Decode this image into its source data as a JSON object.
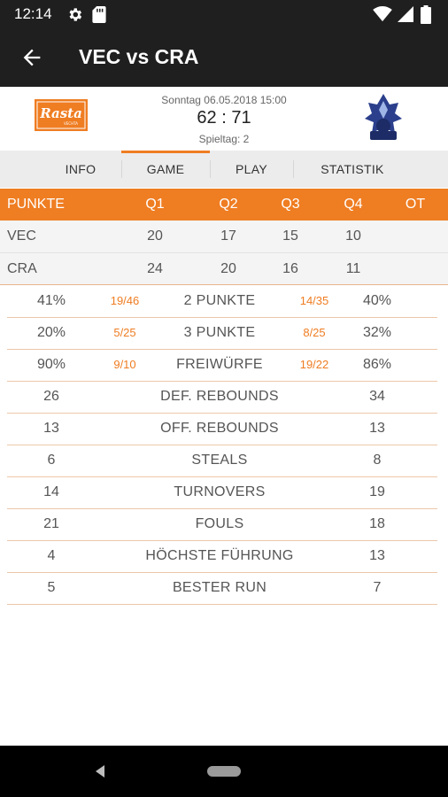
{
  "status_bar": {
    "time": "12:14"
  },
  "app_bar": {
    "title": "VEC vs CRA"
  },
  "game": {
    "date": "Sonntag 06.05.2018 15:00",
    "score": "62 : 71",
    "round": "Spieltag: 2",
    "home_logo_text": "Rasta",
    "home_logo_subtext": "VECHTA"
  },
  "tabs": [
    {
      "label": "INFO",
      "active": false
    },
    {
      "label": "GAME",
      "active": true
    },
    {
      "label": "PLAY",
      "active": false
    },
    {
      "label": "STATISTIK",
      "active": false
    }
  ],
  "quarters": {
    "header": [
      "PUNKTE",
      "Q1",
      "Q2",
      "Q3",
      "Q4",
      "OT"
    ],
    "rows": [
      {
        "team": "VEC",
        "values": [
          "20",
          "17",
          "15",
          "10",
          ""
        ]
      },
      {
        "team": "CRA",
        "values": [
          "24",
          "20",
          "16",
          "11",
          ""
        ]
      }
    ]
  },
  "stats": [
    {
      "left": "41%",
      "left_fraction": "19/46",
      "name": "2 PUNKTE",
      "right_fraction": "14/35",
      "right": "40%"
    },
    {
      "left": "20%",
      "left_fraction": "5/25",
      "name": "3 PUNKTE",
      "right_fraction": "8/25",
      "right": "32%"
    },
    {
      "left": "90%",
      "left_fraction": "9/10",
      "name": "FREIWÜRFE",
      "right_fraction": "19/22",
      "right": "86%"
    },
    {
      "left": "26",
      "left_fraction": "",
      "name": "DEF. REBOUNDS",
      "right_fraction": "",
      "right": "34"
    },
    {
      "left": "13",
      "left_fraction": "",
      "name": "OFF. REBOUNDS",
      "right_fraction": "",
      "right": "13"
    },
    {
      "left": "6",
      "left_fraction": "",
      "name": "STEALS",
      "right_fraction": "",
      "right": "8"
    },
    {
      "left": "14",
      "left_fraction": "",
      "name": "TURNOVERS",
      "right_fraction": "",
      "right": "19"
    },
    {
      "left": "21",
      "left_fraction": "",
      "name": "FOULS",
      "right_fraction": "",
      "right": "18"
    },
    {
      "left": "4",
      "left_fraction": "",
      "name": "HÖCHSTE FÜHRUNG",
      "right_fraction": "",
      "right": "13"
    },
    {
      "left": "5",
      "left_fraction": "",
      "name": "BESTER RUN",
      "right_fraction": "",
      "right": "7"
    }
  ],
  "colors": {
    "accent": "#ef7d22",
    "app_bar": "#1f1f1f",
    "tab_bar": "#ececec",
    "row_bg": "#f4f4f4"
  },
  "icons": {
    "status": [
      "settings-icon",
      "sd-card-icon",
      "wifi-icon",
      "signal-icon",
      "battery-icon"
    ],
    "app_bar": "back-arrow-icon",
    "nav": [
      "nav-back-icon",
      "nav-home-pill"
    ]
  }
}
